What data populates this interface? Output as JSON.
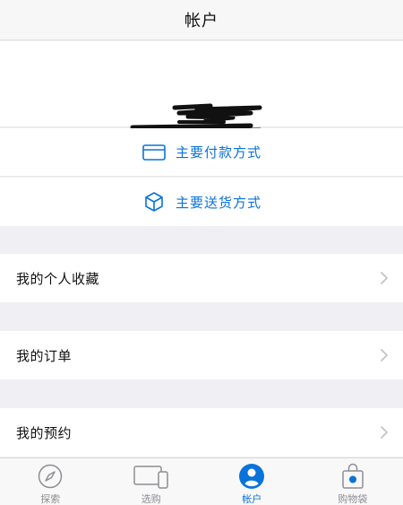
{
  "header": {
    "title": "帐户"
  },
  "actions": {
    "payment_label": "主要付款方式",
    "shipping_label": "主要送货方式"
  },
  "menu": [
    {
      "label": "我的个人收藏"
    },
    {
      "label": "我的订单"
    },
    {
      "label": "我的预约"
    }
  ],
  "tabs": [
    {
      "label": "探索",
      "icon": "compass-icon",
      "active": false
    },
    {
      "label": "选购",
      "icon": "devices-icon",
      "active": false
    },
    {
      "label": "帐户",
      "icon": "person-icon",
      "active": true
    },
    {
      "label": "购物袋",
      "icon": "bag-icon",
      "active": false
    }
  ],
  "colors": {
    "accent": "#0a73d9",
    "background": "#efeff4",
    "text": "#111111",
    "tab_inactive": "#8e8e93"
  }
}
